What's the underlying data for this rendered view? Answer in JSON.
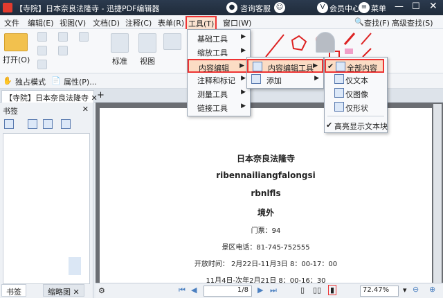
{
  "titlebar": {
    "title": "【寺院】日本奈良法隆寺 - 迅捷PDF编辑器",
    "consult": "咨询客服",
    "member": "会员中心",
    "menu": "菜单"
  },
  "menubar": {
    "items": [
      "文件",
      "编辑(E)",
      "视图(V)",
      "文档(D)",
      "注释(C)",
      "表单(R)",
      "工具(T)",
      "窗口(W)"
    ],
    "find": "查找(F)",
    "advanced_find": "高级查找(S)"
  },
  "ribbon": {
    "open": "打开(O)",
    "standard": "标准",
    "view": "视图"
  },
  "quickbar": {
    "exclusive": "独占模式",
    "properties": "属性(P)..."
  },
  "tabs": {
    "doc": "【寺院】日本奈良法隆寺"
  },
  "sidebar": {
    "title": "书签",
    "tab_bookmark": "书签",
    "tab_thumb": "缩略图"
  },
  "tools_menu": {
    "items": [
      "基础工具",
      "缩放工具",
      "内容编辑",
      "注释和标记",
      "测量工具",
      "链接工具"
    ]
  },
  "content_menu": {
    "items": [
      "内容编辑工具",
      "添加"
    ]
  },
  "editor_menu": {
    "items": [
      "全部内容",
      "仅文本",
      "仅图像",
      "仅形状",
      "高亮显示文本块"
    ]
  },
  "page": {
    "lines": [
      "日本奈良法隆寺",
      "ribennailiangfalongsi",
      "rbnlfls",
      "境外",
      "门票：94",
      "景区电话：81-745-752555",
      "开放时间： 2月22日-11月3日 8：00-17：00",
      "11月4日-次年2月21日 8：00-16：30"
    ]
  },
  "status": {
    "page": "1/8",
    "zoom": "72.47%"
  }
}
